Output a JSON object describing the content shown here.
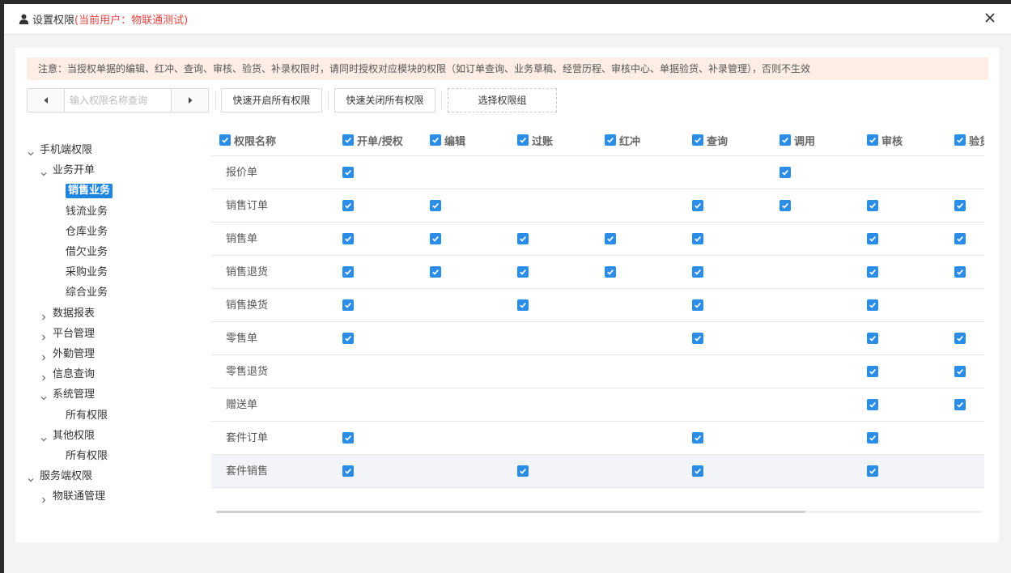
{
  "header": {
    "title": "设置权限",
    "current_user": "(当前用户：物联通测试)",
    "user_icon": "user-icon",
    "close_icon": "close-icon"
  },
  "notice": {
    "text": "注意：当授权单据的编辑、红冲、查询、审核、验货、补录权限时，请同时授权对应模块的权限（如订单查询、业务草稿、经营历程、审核中心、单据验货、补录管理），否则不生效"
  },
  "toolbar": {
    "search_placeholder": "输入权限名称查询",
    "open_all_label": "快速开启所有权限",
    "close_all_label": "快速关闭所有权限",
    "select_group_label": "选择权限组"
  },
  "tree": {
    "nodes": [
      {
        "label": "手机端权限",
        "level": 0,
        "state": "expanded"
      },
      {
        "label": "业务开单",
        "level": 1,
        "state": "expanded"
      },
      {
        "label": "销售业务",
        "level": 2,
        "state": "leaf",
        "selected": true
      },
      {
        "label": "钱流业务",
        "level": 2,
        "state": "leaf"
      },
      {
        "label": "仓库业务",
        "level": 2,
        "state": "leaf"
      },
      {
        "label": "借欠业务",
        "level": 2,
        "state": "leaf"
      },
      {
        "label": "采购业务",
        "level": 2,
        "state": "leaf"
      },
      {
        "label": "综合业务",
        "level": 2,
        "state": "leaf"
      },
      {
        "label": "数据报表",
        "level": 1,
        "state": "collapsed"
      },
      {
        "label": "平台管理",
        "level": 1,
        "state": "collapsed"
      },
      {
        "label": "外勤管理",
        "level": 1,
        "state": "collapsed"
      },
      {
        "label": "信息查询",
        "level": 1,
        "state": "collapsed"
      },
      {
        "label": "系统管理",
        "level": 1,
        "state": "expanded"
      },
      {
        "label": "所有权限",
        "level": 2,
        "state": "leaf"
      },
      {
        "label": "其他权限",
        "level": 1,
        "state": "expanded"
      },
      {
        "label": "所有权限",
        "level": 2,
        "state": "leaf"
      },
      {
        "label": "服务端权限",
        "level": 0,
        "state": "expanded"
      },
      {
        "label": "物联通管理",
        "level": 1,
        "state": "collapsed"
      }
    ]
  },
  "table": {
    "name_header": "权限名称",
    "columns": [
      "开单/授权",
      "编辑",
      "过账",
      "红冲",
      "查询",
      "调用",
      "审核",
      "验货"
    ],
    "rows": [
      {
        "name": "报价单",
        "checks": [
          1,
          0,
          0,
          0,
          0,
          1,
          0,
          0
        ]
      },
      {
        "name": "销售订单",
        "checks": [
          1,
          1,
          0,
          0,
          1,
          1,
          1,
          1
        ]
      },
      {
        "name": "销售单",
        "checks": [
          1,
          1,
          1,
          1,
          1,
          0,
          1,
          1
        ]
      },
      {
        "name": "销售退货",
        "checks": [
          1,
          1,
          1,
          1,
          1,
          0,
          1,
          1
        ]
      },
      {
        "name": "销售换货",
        "checks": [
          1,
          0,
          1,
          0,
          1,
          0,
          1,
          0
        ]
      },
      {
        "name": "零售单",
        "checks": [
          1,
          0,
          0,
          0,
          1,
          0,
          1,
          1
        ]
      },
      {
        "name": "零售退货",
        "checks": [
          0,
          0,
          0,
          0,
          0,
          0,
          1,
          1
        ]
      },
      {
        "name": "赠送单",
        "checks": [
          0,
          0,
          0,
          0,
          0,
          0,
          1,
          1
        ]
      },
      {
        "name": "套件订单",
        "checks": [
          1,
          0,
          0,
          0,
          1,
          0,
          1,
          0
        ]
      },
      {
        "name": "套件销售",
        "checks": [
          1,
          0,
          1,
          0,
          1,
          0,
          1,
          0
        ],
        "highlighted": true
      }
    ]
  },
  "colors": {
    "accent": "#2b8de8",
    "selected_bg": "#1e86e0",
    "user_text": "#e64340",
    "notice_bg": "#fdede5"
  }
}
